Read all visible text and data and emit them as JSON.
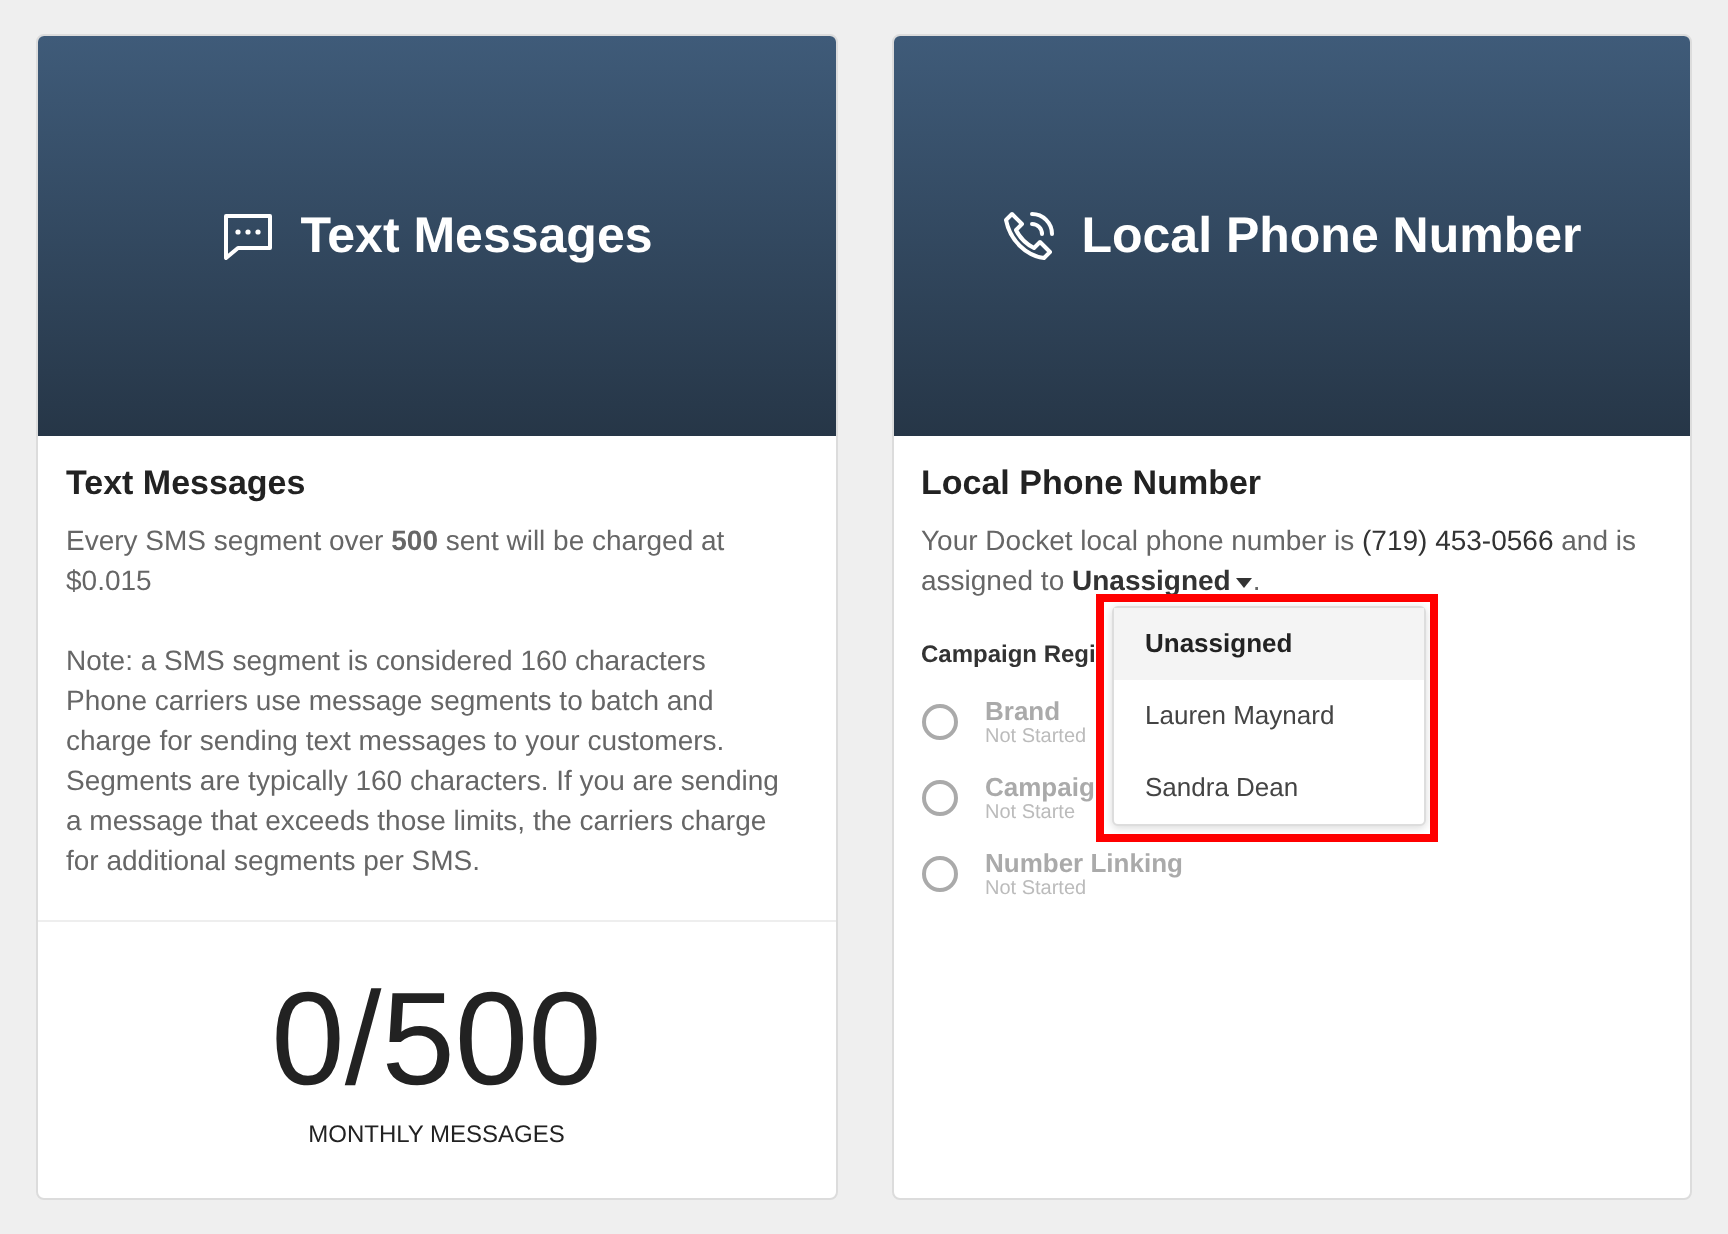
{
  "cards": [
    {
      "banner": "Text Messages",
      "title": "Text Messages",
      "paragraphs": [
        "Every SMS segment over **500**  sent will be charged at $0.015",
        "Note: a SMS segment is considered 160 characters Phone carriers use message segments to batch and charge for sending text messages to your customers. Segments are typically 160 characters. If you are sending a message that exceeds those limits, the carriers charge for additional segments per SMS."
      ],
      "usage": {
        "count": "0/500",
        "label": "MONTHLY MESSAGES"
      }
    },
    {
      "banner": "Local Phone Number",
      "title": "Local Phone Number",
      "sentence": {
        "before": "Your Docket local phone number is",
        "number": "(719) 453-0566",
        "middle": "and is assigned to",
        "assignee": "Unassigned",
        "after": "."
      },
      "section_title": "Campaign Regi",
      "steps": [
        {
          "name": "Brand",
          "status": "Not Started",
          "checked": false
        },
        {
          "name": "Campaig",
          "status": "Not Starte",
          "checked": false
        },
        {
          "name": "Number Linking",
          "status": "Not Started",
          "checked": false
        }
      ],
      "dropdown": {
        "highlighted": true,
        "options": [
          {
            "label": "Unassigned",
            "selected": true
          },
          {
            "label": "Lauren Maynard",
            "selected": false
          },
          {
            "label": "Sandra Dean",
            "selected": false
          }
        ]
      }
    }
  ]
}
